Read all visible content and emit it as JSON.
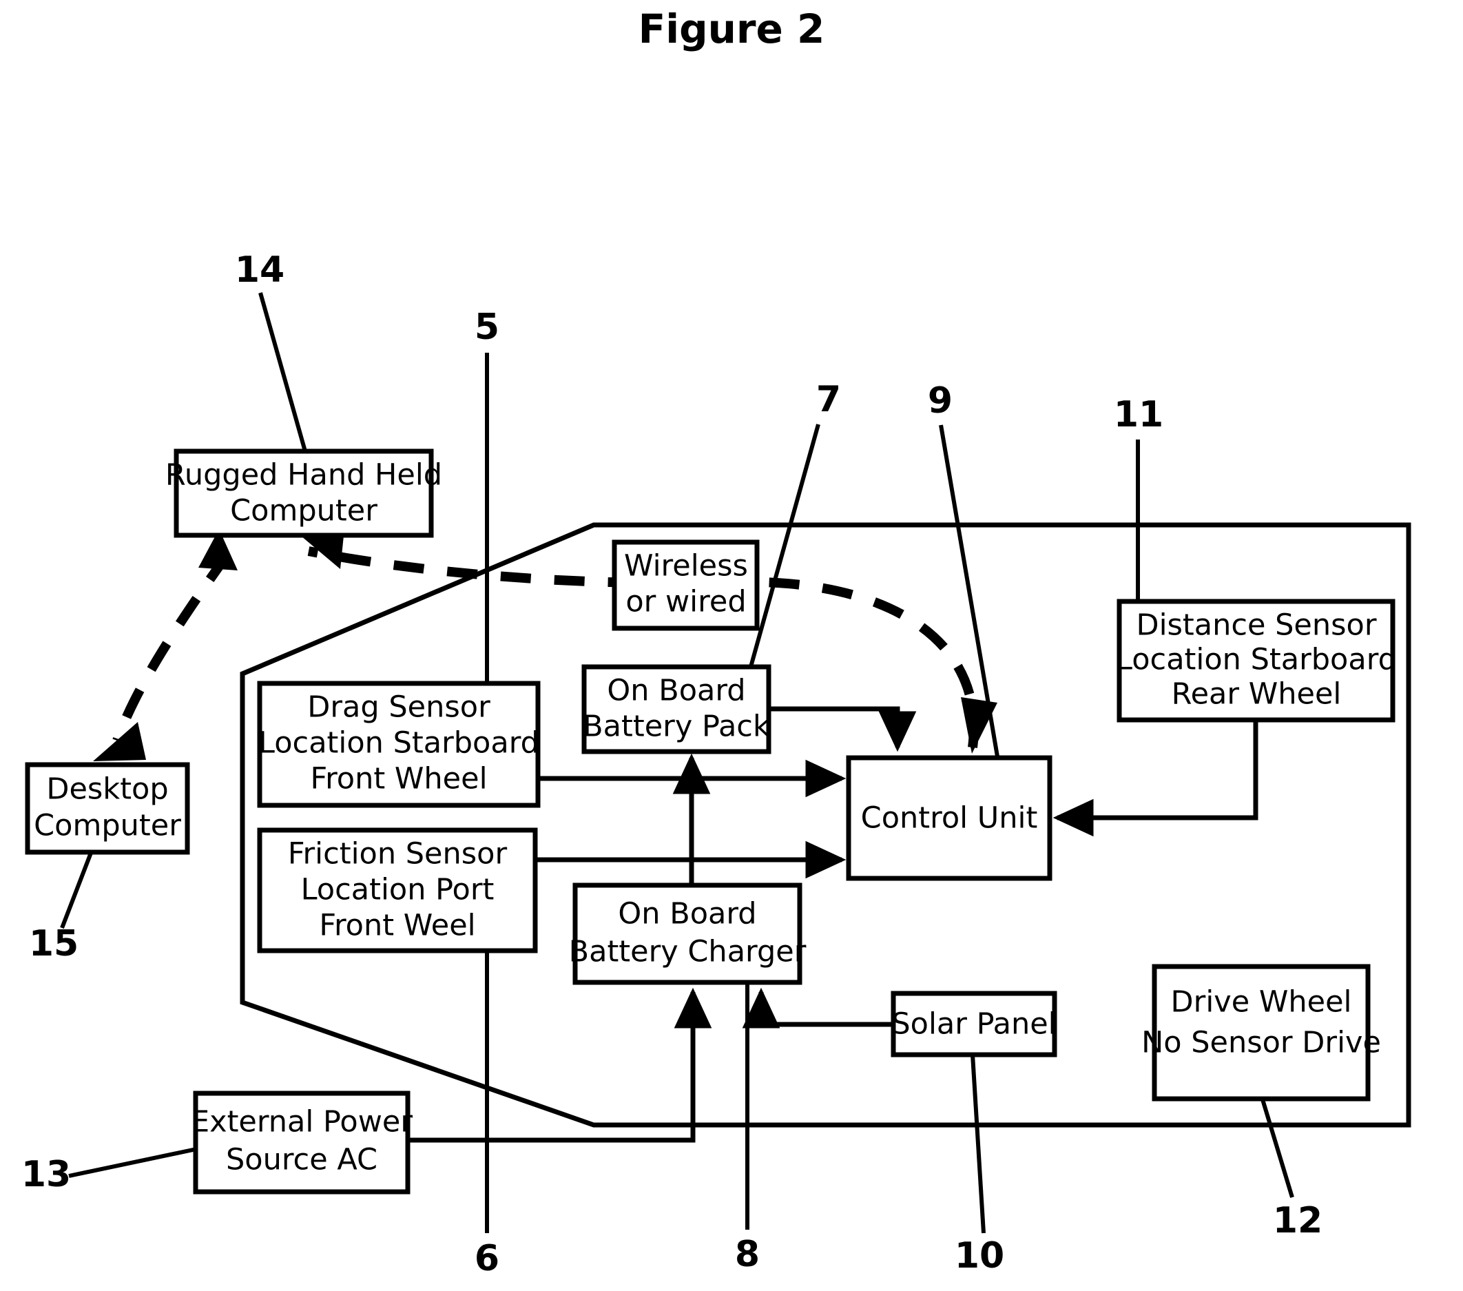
{
  "figure": {
    "title": "Figure 2"
  },
  "boxes": {
    "rugged_handheld": {
      "lines": [
        "Rugged Hand Held",
        "Computer"
      ]
    },
    "desktop_computer": {
      "lines": [
        "Desktop",
        "Computer"
      ]
    },
    "wireless_or_wired": {
      "lines": [
        "Wireless",
        "or wired"
      ]
    },
    "drag_sensor": {
      "lines": [
        "Drag Sensor",
        "Location Starboard",
        "Front Wheel"
      ]
    },
    "friction_sensor": {
      "lines": [
        "Friction Sensor",
        "Location Port",
        "Front Weel"
      ]
    },
    "battery_pack": {
      "lines": [
        "On Board",
        "Battery Pack"
      ]
    },
    "battery_charger": {
      "lines": [
        "On Board",
        "Battery Charger"
      ]
    },
    "control_unit": {
      "lines": [
        "Control Unit"
      ]
    },
    "distance_sensor": {
      "lines": [
        "Distance Sensor",
        "Location Starboard",
        "Rear Wheel"
      ]
    },
    "solar_panel": {
      "lines": [
        "Solar Panel"
      ]
    },
    "drive_wheel": {
      "lines": [
        "Drive Wheel",
        "No Sensor Drive"
      ]
    },
    "external_power": {
      "lines": [
        "External Power",
        "Source AC"
      ]
    }
  },
  "reference_numerals": {
    "n5": "5",
    "n6": "6",
    "n7": "7",
    "n8": "8",
    "n9": "9",
    "n10": "10",
    "n11": "11",
    "n12": "12",
    "n13": "13",
    "n14": "14",
    "n15": "15"
  },
  "colors": {
    "ink": "#000000",
    "paper": "#ffffff"
  }
}
